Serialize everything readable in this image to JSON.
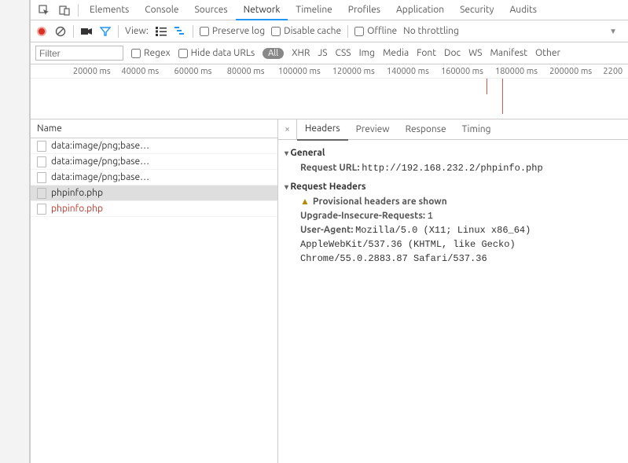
{
  "tabs": [
    "Elements",
    "Console",
    "Sources",
    "Network",
    "Timeline",
    "Profiles",
    "Application",
    "Security",
    "Audits"
  ],
  "active_tab": "Network",
  "toolbar": {
    "view_label": "View:",
    "preserve_log": "Preserve log",
    "disable_cache": "Disable cache",
    "offline": "Offline",
    "throttling": "No throttling"
  },
  "filter": {
    "placeholder": "Filter",
    "regex": "Regex",
    "hide_data_urls": "Hide data URLs",
    "all": "All",
    "types": [
      "XHR",
      "JS",
      "CSS",
      "Img",
      "Media",
      "Font",
      "Doc",
      "WS",
      "Manifest",
      "Other"
    ]
  },
  "timeline_ticks": [
    "20000 ms",
    "40000 ms",
    "60000 ms",
    "80000 ms",
    "100000 ms",
    "120000 ms",
    "140000 ms",
    "160000 ms",
    "180000 ms",
    "200000 ms",
    "2200"
  ],
  "name_header": "Name",
  "requests": [
    {
      "name": "data:image/png;base…",
      "pending": false,
      "selected": false
    },
    {
      "name": "data:image/png;base…",
      "pending": false,
      "selected": false
    },
    {
      "name": "data:image/png;base…",
      "pending": false,
      "selected": false
    },
    {
      "name": "phpinfo.php",
      "pending": false,
      "selected": true
    },
    {
      "name": "phpinfo.php",
      "pending": true,
      "selected": false
    }
  ],
  "detail_tabs": [
    "Headers",
    "Preview",
    "Response",
    "Timing"
  ],
  "detail_active": "Headers",
  "headers": {
    "general_title": "General",
    "request_url_label": "Request URL:",
    "request_url": "http://192.168.232.2/phpinfo.php",
    "request_headers_title": "Request Headers",
    "provisional": "Provisional headers are shown",
    "upgrade_label": "Upgrade-Insecure-Requests:",
    "upgrade_value": "1",
    "ua_label": "User-Agent:",
    "ua_value": "Mozilla/5.0 (X11; Linux x86_64) AppleWebKit/537.36 (KHTML, like Gecko) Chrome/55.0.2883.87 Safari/537.36"
  }
}
